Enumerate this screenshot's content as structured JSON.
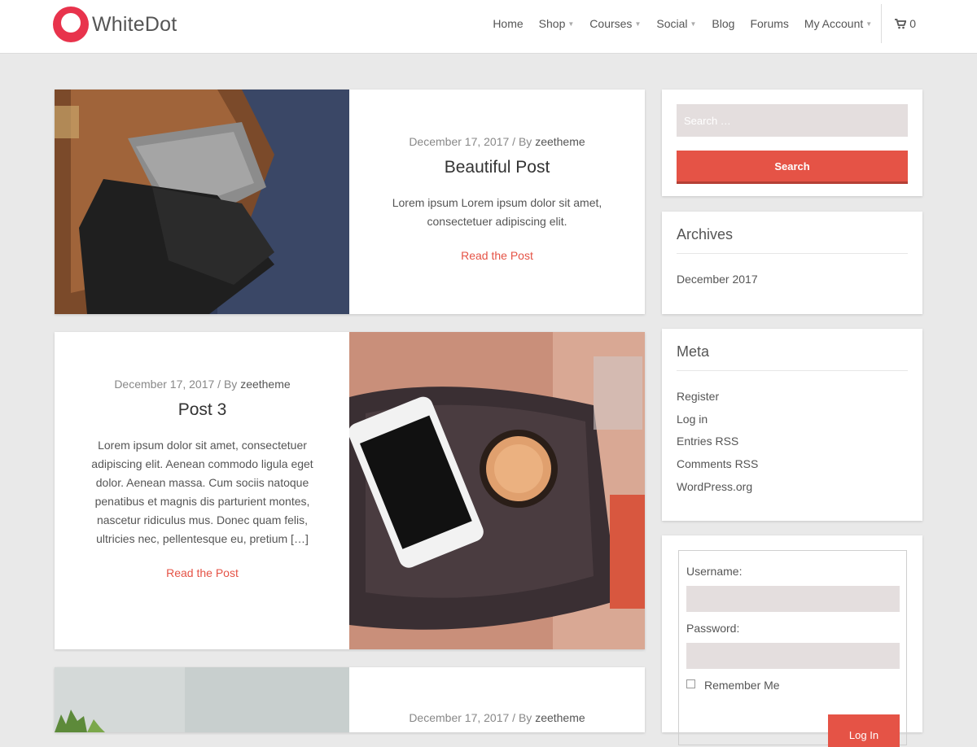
{
  "site": {
    "name": "WhiteDot",
    "accent": "#e55346",
    "logo_color": "#e8334c"
  },
  "nav": {
    "items": [
      {
        "label": "Home",
        "has_submenu": false
      },
      {
        "label": "Shop",
        "has_submenu": true
      },
      {
        "label": "Courses",
        "has_submenu": true
      },
      {
        "label": "Social",
        "has_submenu": true
      },
      {
        "label": "Blog",
        "has_submenu": false
      },
      {
        "label": "Forums",
        "has_submenu": false
      },
      {
        "label": "My Account",
        "has_submenu": true
      }
    ],
    "cart_count": "0",
    "cart_icon": "shopping-cart-icon"
  },
  "posts": [
    {
      "date": "December 17, 2017",
      "by": "/ By",
      "author": "zeetheme",
      "title": "Beautiful Post",
      "excerpt": "Lorem ipsum Lorem ipsum dolor sit amet, consectetuer adipiscing elit.",
      "read_more": "Read the Post",
      "image": "leather bag with tie and wallet"
    },
    {
      "date": "December 17, 2017",
      "by": "/ By",
      "author": "zeetheme",
      "title": "Post 3",
      "excerpt": "Lorem ipsum dolor sit amet, consectetuer adipiscing elit. Aenean commodo ligula eget dolor. Aenean massa. Cum sociis natoque penatibus et magnis dis parturient montes, nascetur ridiculus mus. Donec quam felis, ultricies nec, pellentesque eu, pretium […]",
      "read_more": "Read the Post",
      "image": "phone and coffee on motorcycle seat"
    },
    {
      "date": "December 17, 2017",
      "by": "/ By",
      "author": "zeetheme",
      "image": "plant on light background"
    }
  ],
  "sidebar": {
    "search": {
      "placeholder": "Search …",
      "button": "Search"
    },
    "archives": {
      "title": "Archives",
      "items": [
        "December 2017"
      ]
    },
    "meta": {
      "title": "Meta",
      "items": [
        "Register",
        "Log in",
        "Entries RSS",
        "Comments RSS",
        "WordPress.org"
      ]
    },
    "login": {
      "username_label": "Username:",
      "password_label": "Password:",
      "remember_label": "Remember Me",
      "button": "Log In"
    }
  }
}
